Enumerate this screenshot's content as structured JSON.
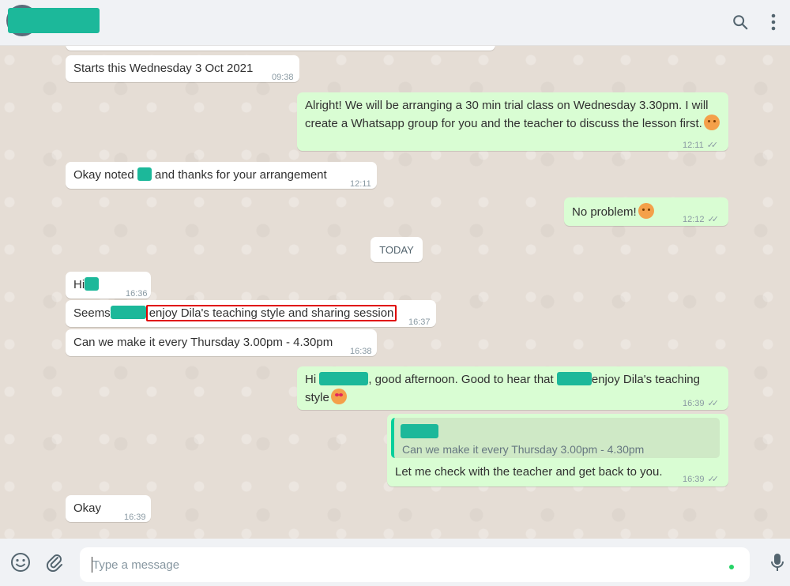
{
  "header": {
    "icons": [
      "search-icon",
      "menu-icon"
    ]
  },
  "messages": {
    "m0": {
      "text": "Starts this Wednesday 3 Oct 2021",
      "time": "09:38"
    },
    "m1": {
      "line1": "Alright! We will be arranging a 30 min trial class on Wednesday 3.30pm. I will",
      "line2": "create a Whatsapp group for you and the teacher to discuss the lesson first.",
      "time": "12:11"
    },
    "m2": {
      "text_a": "Okay noted",
      "text_b": " and thanks for your arrangement",
      "time": "12:11"
    },
    "m3": {
      "text": "No problem!",
      "time": "12:12"
    },
    "date_chip": "TODAY",
    "m4": {
      "text": "Hi",
      "time": "16:36"
    },
    "m5": {
      "text_a": "Seems",
      "text_b": "enjoy Dila's teaching style and sharing session",
      "time": "16:37"
    },
    "m6": {
      "text": "Can we make it every Thursday 3.00pm - 4.30pm",
      "time": "16:38"
    },
    "m7": {
      "text_a": "Hi",
      "text_b": ", good afternoon. Good to hear that",
      "text_c": "enjoy Dila's teaching",
      "line2": "style",
      "time": "16:39"
    },
    "m8": {
      "quoted": "Can we make it every Thursday 3.00pm - 4.30pm",
      "text": "Let me check with the teacher and get back to you.",
      "time": "16:39"
    },
    "m9": {
      "text": "Okay",
      "time": "16:39"
    }
  },
  "footer": {
    "placeholder": "Type a message",
    "icons": [
      "emoji-icon",
      "attach-icon",
      "mic-icon"
    ]
  },
  "colors": {
    "outgoing": "#d9fdd3",
    "incoming": "#ffffff",
    "redaction": "#1cb89a",
    "highlight": "#e00000"
  }
}
